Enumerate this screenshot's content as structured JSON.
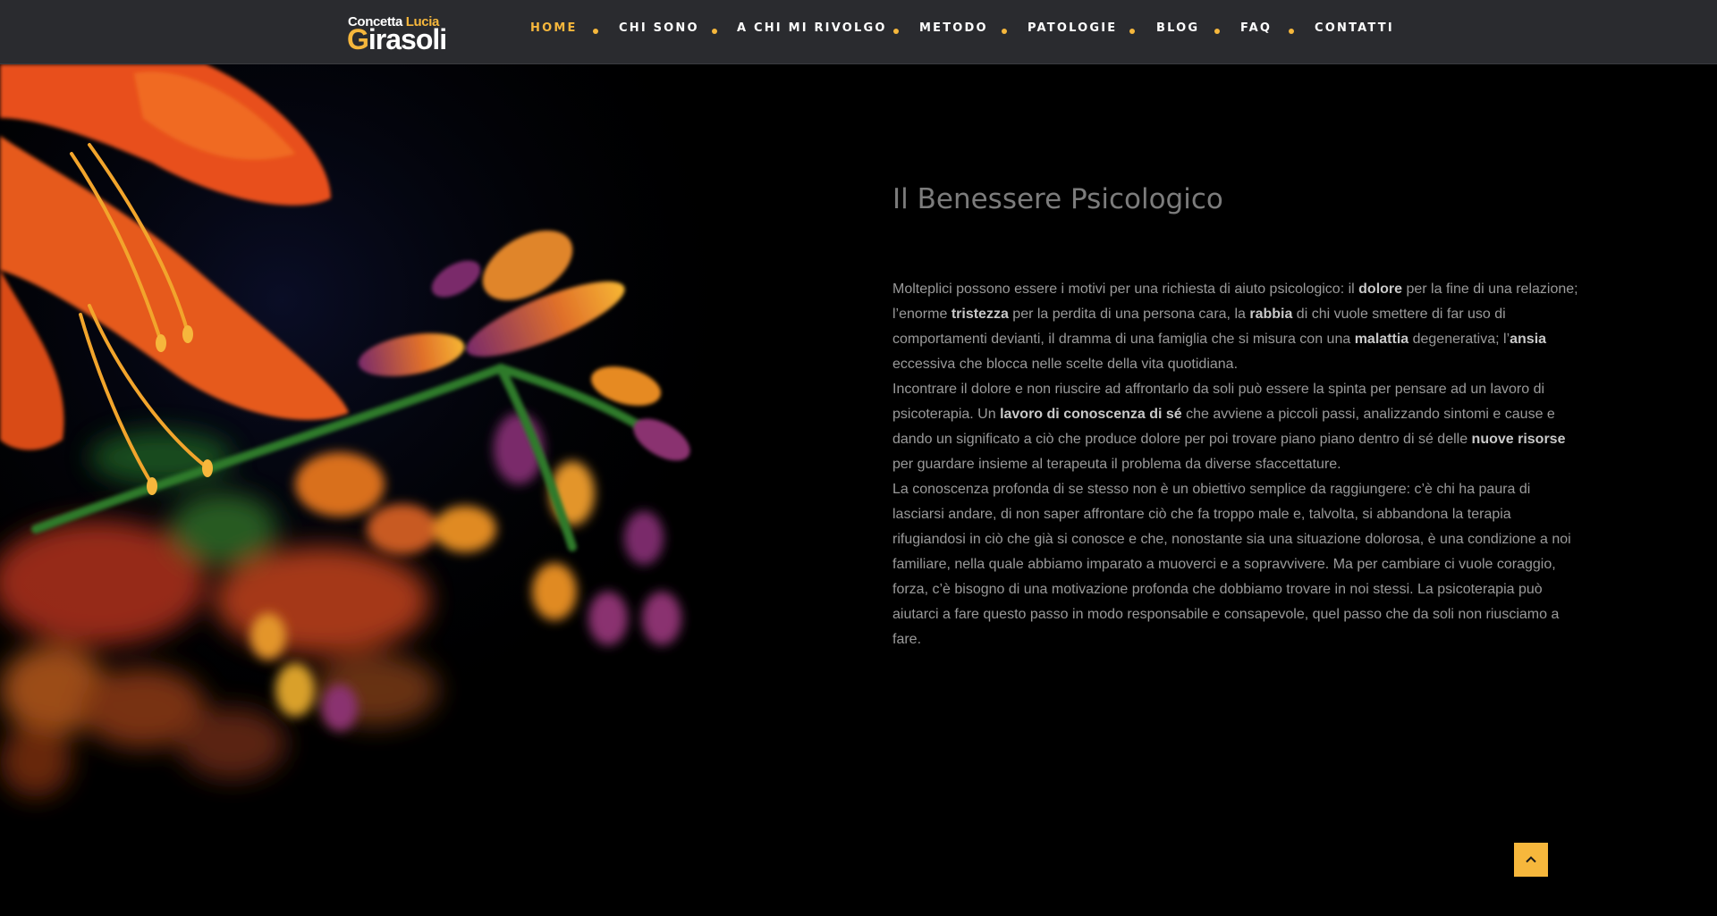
{
  "logo": {
    "line1_a": "Concetta ",
    "line1_b": "Lucia",
    "line2_a": "G",
    "line2_b": "irasoli"
  },
  "nav": {
    "items": [
      {
        "label": "HOME",
        "active": true
      },
      {
        "label": "CHI SONO"
      },
      {
        "label": "A CHI MI RIVOLGO"
      },
      {
        "label": "METODO"
      },
      {
        "label": "PATOLOGIE"
      },
      {
        "label": "BLOG"
      },
      {
        "label": "FAQ"
      },
      {
        "label": "CONTATTI"
      }
    ]
  },
  "main": {
    "title": "Il Benessere Psicologico",
    "paragraphs": [
      [
        {
          "t": "Molteplici possono essere i motivi per una richiesta di aiuto psicologico: il "
        },
        {
          "t": "dolore",
          "b": true
        },
        {
          "t": " per la fine di una relazione; l’enorme "
        },
        {
          "t": "tristezza",
          "b": true
        },
        {
          "t": " per la perdita di una persona cara, la "
        },
        {
          "t": "rabbia",
          "b": true
        },
        {
          "t": " di chi vuole smettere di far uso di comportamenti devianti, il dramma di una famiglia che si misura con una "
        },
        {
          "t": "malattia",
          "b": true
        },
        {
          "t": " degenerativa; l’"
        },
        {
          "t": "ansia",
          "b": true
        },
        {
          "t": " eccessiva che blocca nelle scelte della vita quotidiana."
        }
      ],
      [
        {
          "t": "Incontrare il dolore e non riuscire ad affrontarlo da soli può essere la spinta per pensare ad un lavoro di psicoterapia. Un "
        },
        {
          "t": "lavoro di conoscenza di sé",
          "b": true
        },
        {
          "t": " che avviene a piccoli passi, analizzando sintomi e cause e dando un significato a ciò che produce dolore per poi trovare piano piano dentro di sé delle "
        },
        {
          "t": "nuove risorse",
          "b": true
        },
        {
          "t": " per guardare insieme al terapeuta il problema da diverse sfaccettature."
        }
      ],
      [
        {
          "t": "La conoscenza profonda di se stesso non è un obiettivo semplice da raggiungere: c’è chi ha paura di lasciarsi andare, di non saper affrontare ciò che fa troppo male e, talvolta, si abbandona la terapia rifugiandosi in ciò che già si conosce e che, nonostante sia una situazione dolorosa, è una condizione a noi familiare, nella quale abbiamo imparato a muoverci e a sopravvivere. Ma per cambiare ci vuole coraggio, forza, c’è bisogno di una motivazione profonda che dobbiamo trovare in noi stessi. La psicoterapia può aiutarci a fare questo passo in modo responsabile e consapevole, quel passo che da soli non riusciamo a fare."
        }
      ]
    ]
  },
  "icons": {
    "back_to_top": "chevron-up-icon",
    "hero": "orange-flower-photo"
  },
  "colors": {
    "accent": "#f6b73c",
    "header_bg": "#2a2b2f",
    "page_bg": "#000000",
    "title": "#7c7c7c",
    "body_text": "#9a9a9a"
  }
}
